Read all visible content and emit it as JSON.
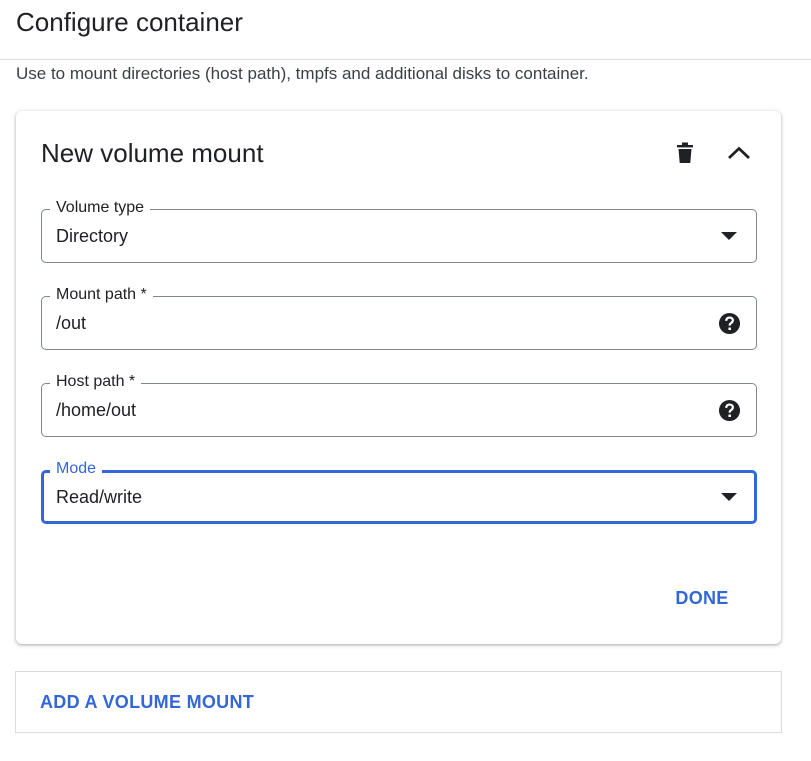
{
  "header": {
    "title": "Configure container"
  },
  "description": "Use to mount directories (host path), tmpfs and additional disks to container.",
  "card": {
    "title": "New volume mount",
    "delete_icon": "trash-icon",
    "collapse_icon": "chevron-up-icon",
    "fields": {
      "volume_type": {
        "label": "Volume type",
        "value": "Directory",
        "icon": "dropdown-arrow-icon"
      },
      "mount_path": {
        "label": "Mount path *",
        "value": "/out",
        "icon": "help-icon"
      },
      "host_path": {
        "label": "Host path *",
        "value": "/home/out",
        "icon": "help-icon"
      },
      "mode": {
        "label": "Mode",
        "value": "Read/write",
        "icon": "dropdown-arrow-icon",
        "focused": true
      }
    },
    "done_label": "DONE"
  },
  "add_mount_label": "ADD A VOLUME MOUNT",
  "colors": {
    "accent": "#3367d6",
    "text": "#202124",
    "border": "#80868b",
    "divider": "#dadce0"
  }
}
